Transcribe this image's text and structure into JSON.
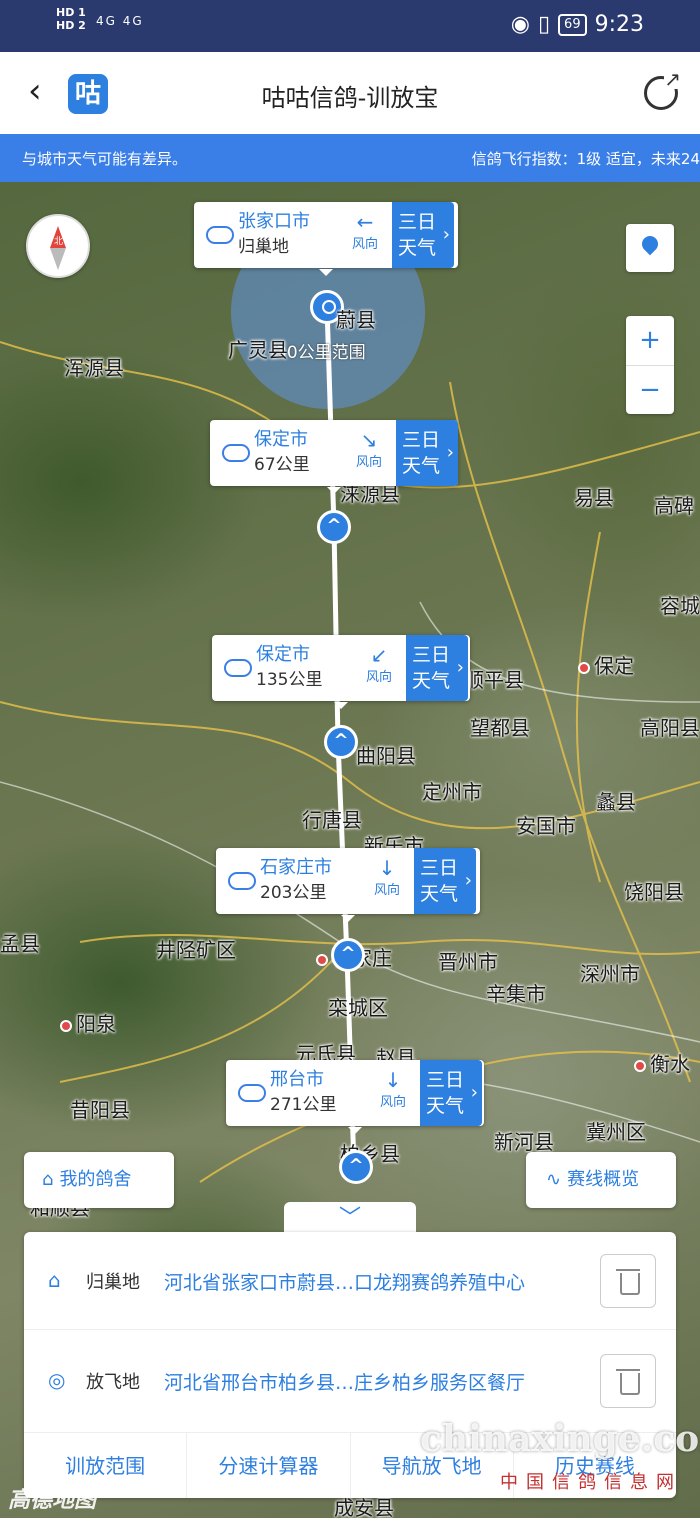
{
  "status_bar": {
    "sim_labels": "HD 1\nHD 2",
    "signal": "4G 4G",
    "battery": "69",
    "time": "9:23"
  },
  "header": {
    "logo_char": "咕",
    "title": "咕咕信鸽-训放宝"
  },
  "banner": {
    "left": "与城市天气可能有差异。",
    "right": "信鸽飞行指数：1级 适宜，未来24"
  },
  "map": {
    "range_label": "30公里范围",
    "place_labels": [
      {
        "text": "蔚县"
      },
      {
        "text": "广灵县"
      },
      {
        "text": "浑源县"
      },
      {
        "text": "涞源县"
      },
      {
        "text": "易县"
      },
      {
        "text": "高碑"
      },
      {
        "text": "容城"
      },
      {
        "text": "顺平县"
      },
      {
        "text": "保定"
      },
      {
        "text": "望都县"
      },
      {
        "text": "高阳县"
      },
      {
        "text": "曲阳县"
      },
      {
        "text": "定州市"
      },
      {
        "text": "行唐县"
      },
      {
        "text": "安国市"
      },
      {
        "text": "蠡县"
      },
      {
        "text": "新乐市"
      },
      {
        "text": "饶阳县"
      },
      {
        "text": "孟县"
      },
      {
        "text": "井陉矿区"
      },
      {
        "text": "石家庄"
      },
      {
        "text": "晋州市"
      },
      {
        "text": "深州市"
      },
      {
        "text": "栾城区"
      },
      {
        "text": "辛集市"
      },
      {
        "text": "阳泉"
      },
      {
        "text": "元氏县"
      },
      {
        "text": "赵县"
      },
      {
        "text": "衡水"
      },
      {
        "text": "昔阳县"
      },
      {
        "text": "新河县"
      },
      {
        "text": "冀州区"
      },
      {
        "text": "柏乡县"
      },
      {
        "text": "和顺县"
      },
      {
        "text": "成安县"
      }
    ],
    "compass_label": "北",
    "zoom_in": "+",
    "zoom_out": "−"
  },
  "route_cards": [
    {
      "city": "张家口市",
      "sub": "归巢地",
      "wind_arrow": "←",
      "wind_label": "风向",
      "action": "三日\n天气"
    },
    {
      "city": "保定市",
      "sub": "67公里",
      "wind_arrow": "↘",
      "wind_label": "风向",
      "action": "三日\n天气"
    },
    {
      "city": "保定市",
      "sub": "135公里",
      "wind_arrow": "↙",
      "wind_label": "风向",
      "action": "三日\n天气"
    },
    {
      "city": "石家庄市",
      "sub": "203公里",
      "wind_arrow": "↓",
      "wind_label": "风向",
      "action": "三日\n天气"
    },
    {
      "city": "邢台市",
      "sub": "271公里",
      "wind_arrow": "↓",
      "wind_label": "风向",
      "action": "三日\n天气"
    }
  ],
  "buttons": {
    "my_loft": "我的鸽舍",
    "route_overview": "赛线概览",
    "collapse": "﹀"
  },
  "panel": {
    "home_label": "归巢地",
    "home_value": "河北省张家口市蔚县…口龙翔赛鸽养殖中心",
    "release_label": "放飞地",
    "release_value": "河北省邢台市柏乡县…庄乡柏乡服务区餐厅",
    "tabs": [
      "训放范围",
      "分速计算器",
      "导航放飞地",
      "历史赛线"
    ]
  },
  "watermark": {
    "domain": "chinaxinge.com",
    "cn": "中国信鸽信息网",
    "amap": "高德地图"
  }
}
